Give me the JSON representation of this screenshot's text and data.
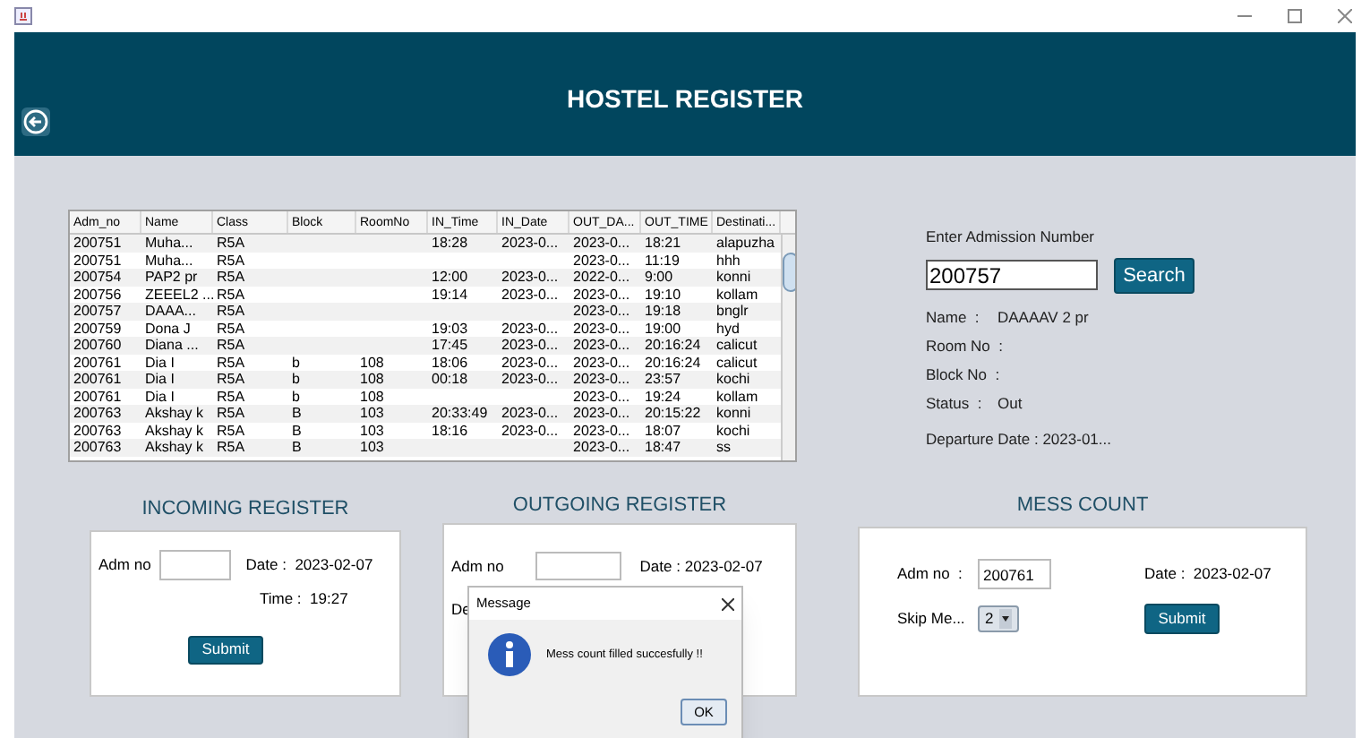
{
  "header": {
    "title": "HOSTEL REGISTER"
  },
  "table": {
    "columns": [
      "Adm_no",
      "Name",
      "Class",
      "Block",
      "RoomNo",
      "IN_Time",
      "IN_Date",
      "OUT_DA...",
      "OUT_TIME",
      "Destinati..."
    ],
    "rows": [
      [
        "200751",
        "Muha...",
        "R5A",
        "",
        "",
        "18:28",
        "2023-0...",
        "2023-0...",
        "18:21",
        "alapuzha"
      ],
      [
        "200751",
        "Muha...",
        "R5A",
        "",
        "",
        "",
        "",
        "2023-0...",
        "11:19",
        "hhh"
      ],
      [
        "200754",
        "PAP2 pr",
        "R5A",
        "",
        "",
        "12:00",
        "2023-0...",
        "2022-0...",
        "9:00",
        "konni"
      ],
      [
        "200756",
        "ZEEEL2 ...",
        "R5A",
        "",
        "",
        "19:14",
        "2023-0...",
        "2023-0...",
        "19:10",
        "kollam"
      ],
      [
        "200757",
        "DAAA...",
        "R5A",
        "",
        "",
        "",
        "",
        "2023-0...",
        "19:18",
        "bnglr"
      ],
      [
        "200759",
        "Dona J",
        "R5A",
        "",
        "",
        "19:03",
        "2023-0...",
        "2023-0...",
        "19:00",
        "hyd"
      ],
      [
        "200760",
        "Diana ...",
        "R5A",
        "",
        "",
        "17:45",
        "2023-0...",
        "2023-0...",
        "20:16:24",
        "calicut"
      ],
      [
        "200761",
        "Dia I",
        "R5A",
        "b",
        "108",
        "18:06",
        "2023-0...",
        "2023-0...",
        "20:16:24",
        "calicut"
      ],
      [
        "200761",
        "Dia I",
        "R5A",
        "b",
        "108",
        "00:18",
        "2023-0...",
        "2023-0...",
        "23:57",
        "kochi"
      ],
      [
        "200761",
        "Dia I",
        "R5A",
        "b",
        "108",
        "",
        "",
        "2023-0...",
        "19:24",
        "kollam"
      ],
      [
        "200763",
        "Akshay k",
        "R5A",
        "B",
        "103",
        "20:33:49",
        "2023-0...",
        "2023-0...",
        "20:15:22",
        "konni"
      ],
      [
        "200763",
        "Akshay k",
        "R5A",
        "B",
        "103",
        "18:16",
        "2023-0...",
        "2023-0...",
        "18:07",
        "kochi"
      ],
      [
        "200763",
        "Akshay k",
        "R5A",
        "B",
        "103",
        "",
        "",
        "2023-0...",
        "18:47",
        "ss"
      ]
    ]
  },
  "search": {
    "label": "Enter Admission Number",
    "value": "200757",
    "button": "Search"
  },
  "details": [
    {
      "label": "Name  :",
      "value": "DAAAAV 2 pr"
    },
    {
      "label": "Room No  :"
    },
    {
      "label": "Block No  :"
    },
    {
      "label": "Status  :",
      "value": "Out"
    }
  ],
  "departure": "Departure Date : 2023-01...",
  "incoming": {
    "title": "INCOMING REGISTER",
    "adm_label": "Adm no",
    "date_label": "Date :",
    "date": "2023-02-07",
    "time_label": "Time :",
    "time": "19:27",
    "submit": "Submit"
  },
  "outgoing": {
    "title": "OUTGOING REGISTER",
    "adm_label": "Adm no",
    "date_label": "Date :",
    "date": "2023-02-07",
    "third_label": "De"
  },
  "mess": {
    "title": "MESS COUNT",
    "adm_label": "Adm no  :",
    "adm_value": "200761",
    "date_label": "Date :",
    "date": "2023-02-07",
    "skip_label": "Skip Me...",
    "skip_value": "2",
    "submit": "Submit"
  },
  "dialog": {
    "title": "Message",
    "message": "Mess count filled succesfully !!",
    "ok": "OK"
  }
}
